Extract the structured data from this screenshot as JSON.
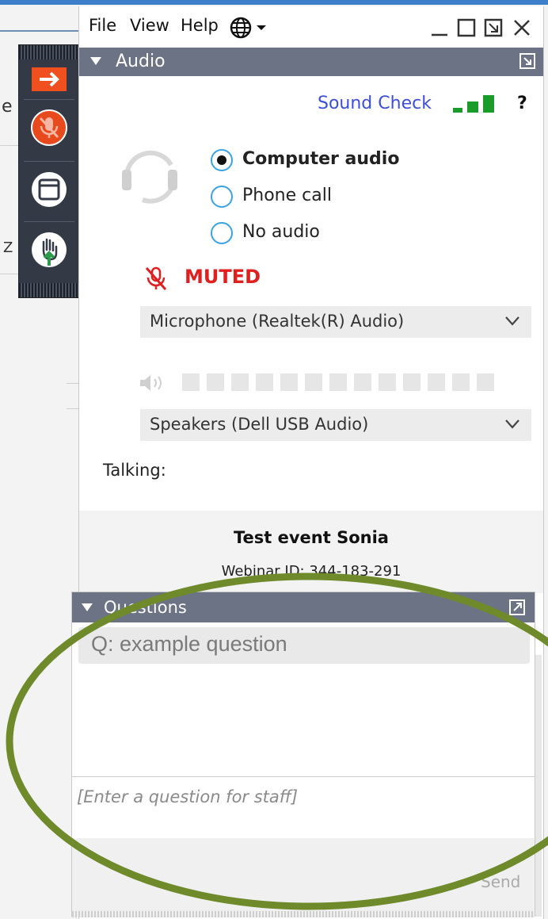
{
  "menu": {
    "file": "File",
    "view": "View",
    "help": "Help"
  },
  "audio": {
    "title": "Audio",
    "sound_check": "Sound Check",
    "help_mark": "?",
    "options": [
      "Computer audio",
      "Phone call",
      "No audio"
    ],
    "selected_option": "Computer audio",
    "muted_label": "MUTED",
    "microphone": "Microphone (Realtek(R) Audio)",
    "speakers": "Speakers (Dell USB Audio)",
    "talking_label": "Talking:",
    "event_title": "Test event Sonia",
    "webinar_id": "Webinar ID: 344-183-291"
  },
  "questions": {
    "title": "Questions",
    "items": [
      "Q: example question"
    ],
    "input_placeholder": "[Enter a question for staff]",
    "send_label": "Send"
  },
  "background": {
    "fragment_1": "e",
    "fragment_2": "Z"
  },
  "colors": {
    "header_bg": "#6b7384",
    "muted_red": "#e01f1f",
    "link_blue": "#3b4fd8",
    "signal_green": "#1a9c2a",
    "radio_blue": "#3aa3e0",
    "annotation_circle": "#6e8a2a",
    "toolbar_bg": "#333a45",
    "toolbar_accent": "#f0501e"
  },
  "icons": {
    "toolbar": [
      "arrow-right-icon",
      "mic-muted-icon",
      "window-icon",
      "raise-hand-icon"
    ],
    "menu": [
      "globe-icon",
      "chevron-down-icon"
    ],
    "window_controls": [
      "minimize-icon",
      "maximize-icon",
      "restore-icon",
      "close-icon"
    ],
    "audio": [
      "headset-icon",
      "mic-muted-icon",
      "speaker-icon",
      "signal-bars-icon"
    ]
  }
}
